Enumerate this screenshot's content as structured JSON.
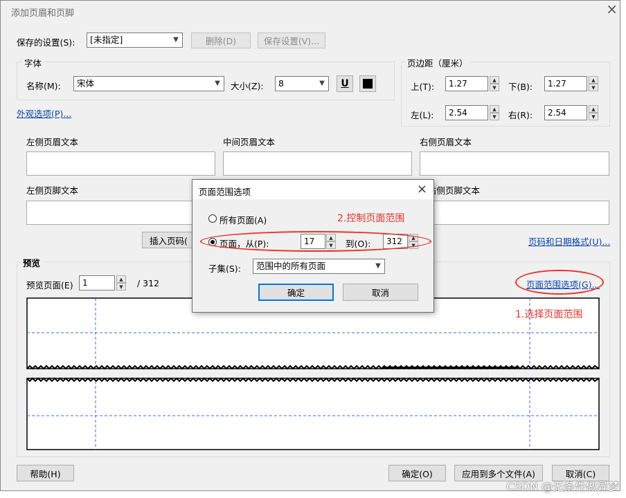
{
  "window": {
    "title": "添加页眉和页脚",
    "close_icon": "×"
  },
  "saved_settings": {
    "label": "保存的设置(S):",
    "value": "[未指定]",
    "delete_label": "删除(D)",
    "save_label": "保存设置(V)..."
  },
  "font": {
    "group_label": "字体",
    "name_label": "名称(M):",
    "name_value": "宋体",
    "size_label": "大小(Z):",
    "size_value": "8",
    "underline_icon": "U"
  },
  "margins": {
    "group_label": "页边距（厘米）",
    "top_label": "上(T):",
    "top_value": "1.27",
    "bottom_label": "下(B):",
    "bottom_value": "1.27",
    "left_label": "左(L):",
    "left_value": "2.54",
    "right_label": "右(R):",
    "right_value": "2.54"
  },
  "appearance_link": "外观选项(P)...",
  "header_footer": {
    "left_header": "左侧页眉文本",
    "center_header": "中间页眉文本",
    "right_header": "右侧页眉文本",
    "left_footer": "左侧页脚文本",
    "right_footer": "右侧页脚文本"
  },
  "insert_page_number_label": "插入页码(",
  "page_date_format_link": "页码和日期格式(U)...",
  "preview": {
    "group_label": "预览",
    "page_label": "预览页面(E)",
    "page_value": "1",
    "total": "/ 312",
    "page_range_link": "页面范围选项(G)..."
  },
  "footer_buttons": {
    "help": "帮助(H)",
    "ok": "确定(O)",
    "apply_multiple": "应用到多个文件(A)",
    "cancel": "取消(C)"
  },
  "dialog": {
    "title": "页面范围选项",
    "all_pages_label": "所有页面(A)",
    "pages_from_label": "页面，从(P):",
    "from_value": "17",
    "to_label": "到(O):",
    "to_value": "312",
    "subset_label": "子集(S):",
    "subset_value": "范围中的所有页面",
    "ok": "确定",
    "cancel": "取消"
  },
  "annotations": {
    "step1": "1.选择页面范围",
    "step2": "2.控制页面范围",
    "color": "#e8332a"
  },
  "watermark": "CSDN @无条件做异梦"
}
